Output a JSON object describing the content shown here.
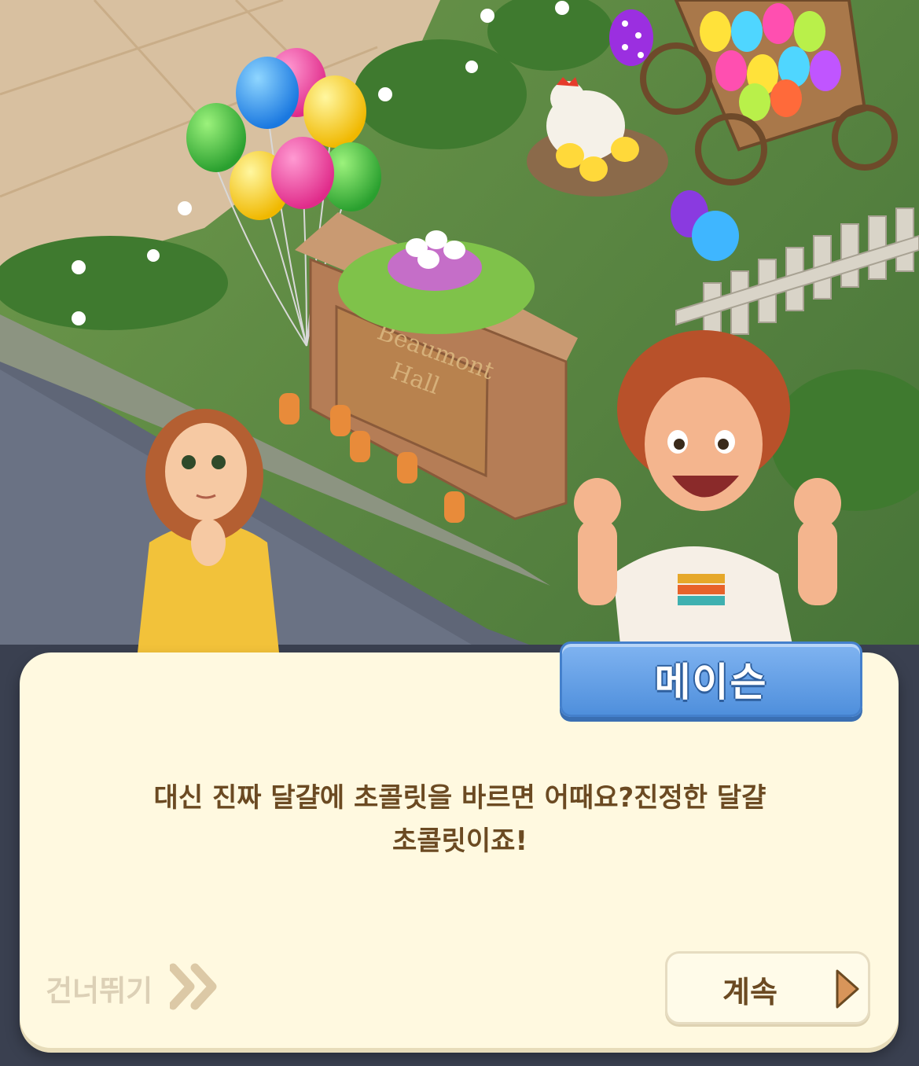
{
  "scene": {
    "sign_text": [
      "Beaumont",
      "Hall"
    ]
  },
  "dialog": {
    "speaker": "메이슨",
    "lines": [
      "대신 진짜 달걀에 초콜릿을 바르면 어때요?진정한 달걀",
      "초콜릿이죠!"
    ]
  },
  "controls": {
    "skip_label": "건너뛰기",
    "continue_label": "계속"
  },
  "colors": {
    "dialog_bg": "#fff9e0",
    "text_brown": "#6b4a22",
    "name_tag_blue": "#5c9ae2",
    "skip_gray": "#dcd0b6"
  }
}
